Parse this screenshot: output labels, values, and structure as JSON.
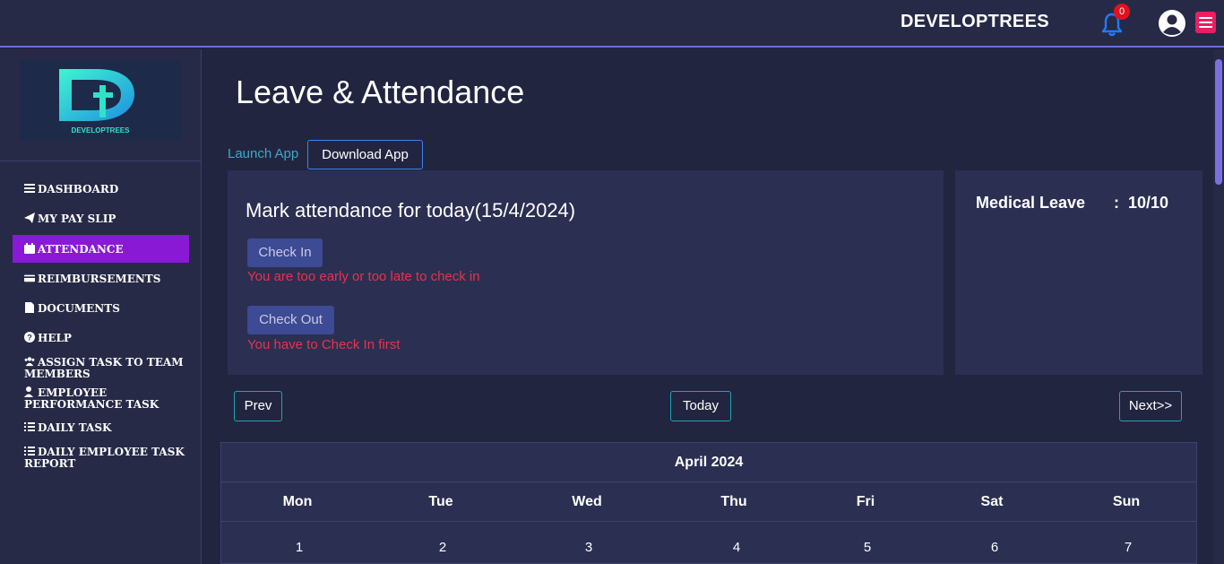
{
  "header": {
    "brand": "DEVELOPTREES",
    "notification_count": "0",
    "icons": [
      "bell-icon",
      "user-circle-icon",
      "hamburger-menu-icon"
    ]
  },
  "sidebar": {
    "logo_text": "DEVELOPTREES",
    "items": [
      {
        "label": "DASHBOARD",
        "icon": "list-icon"
      },
      {
        "label": "MY PAY SLIP",
        "icon": "paper-plane-icon"
      },
      {
        "label": "ATTENDANCE",
        "icon": "calendar-icon",
        "active": true
      },
      {
        "label": "REIMBURSEMENTS",
        "icon": "credit-card-icon"
      },
      {
        "label": "DOCUMENTS",
        "icon": "file-icon"
      },
      {
        "label": "HELP",
        "icon": "question-circle-icon"
      },
      {
        "label": "ASSIGN TASK TO TEAM MEMBERS",
        "icon": "users-icon"
      },
      {
        "label": "EMPLOYEE PERFORMANCE TASK",
        "icon": "user-edit-icon"
      },
      {
        "label": "DAILY TASK",
        "icon": "tasks-icon"
      },
      {
        "label": "DAILY EMPLOYEE TASK REPORT",
        "icon": "tasks-icon"
      }
    ]
  },
  "main": {
    "title": "Leave & Attendance",
    "launch_link": "Launch App",
    "download_button": "Download App",
    "attendance": {
      "title": "Mark attendance for today(15/4/2024)",
      "check_in_label": "Check In",
      "check_in_error": "You are too early or too late to check in",
      "check_out_label": "Check Out",
      "check_out_error": "You have to Check In first"
    },
    "leave": {
      "label": "Medical Leave",
      "separator": ":",
      "value": "10/10"
    },
    "calendar_nav": {
      "prev": "Prev",
      "today": "Today",
      "next": "Next>>"
    },
    "calendar": {
      "month": "April 2024",
      "weekdays": [
        "Mon",
        "Tue",
        "Wed",
        "Thu",
        "Fri",
        "Sat",
        "Sun"
      ],
      "first_row": [
        "1",
        "2",
        "3",
        "4",
        "5",
        "6",
        "7"
      ]
    }
  },
  "colors": {
    "background": "#222540",
    "panel": "#2b2f52",
    "active_nav": "#8a19d6",
    "error": "#e8334a",
    "link": "#3da9c8",
    "badge": "#e3111c",
    "menu_button": "#e91e63"
  }
}
